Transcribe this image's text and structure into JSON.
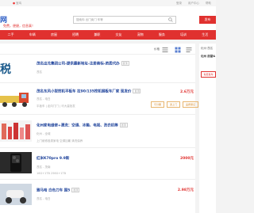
{
  "topbar": {
    "location": "宝鸡",
    "links": [
      "登录",
      "用户中心",
      "帮助"
    ]
  },
  "header": {
    "logo": "网",
    "slogan": "免费，便捷，信息真！",
    "search_placeholder": "搜索你 出门卖门 车等",
    "post_label": "发布"
  },
  "nav": [
    "二手",
    "车辆",
    "房屋",
    "招聘",
    "兼职",
    "交友",
    "宠物",
    "服务",
    "培训",
    "生活"
  ],
  "filter": {
    "price_sort": "价格"
  },
  "listings": [
    {
      "title": "茂名出兑集团公司-提供最新地址-注册商标-资质代办",
      "tag": "置顶",
      "sub": "茂名",
      "sub2": "",
      "price": "",
      "chips": []
    },
    {
      "title": "茂名东风小型挖机平板车 拉90/135挖机钢板车厂家 现发价",
      "tag": "置顶",
      "sub": "茂名 - 电白",
      "sub2": "平板车 | 走向门门 | 可大量批发",
      "price": "2.6万元",
      "chips": [
        "可分期",
        "送上门",
        "品质保证"
      ]
    },
    {
      "title": "化州家电维修+清洗：空调、冰箱、电视、洗衣机等",
      "tag": "置顶",
      "sub": "化州 - 全城",
      "sub2": "上门维修各类家电 空调加氟 清洗保养",
      "price": "",
      "chips": []
    },
    {
      "title": "红米K70pro 9.9新",
      "tag": "",
      "sub": "茂名 - 茂南",
      "sub2": "16G+1TB 256G+1TB",
      "price": "2000元",
      "chips": []
    },
    {
      "title": "雅马哈 白色刀车 国5",
      "tag": "置顶",
      "sub": "茂名 - 电白",
      "sub2": "",
      "price": "2.98万元",
      "chips": []
    }
  ],
  "side": {
    "line1": "化州·茂名",
    "line2": "化州 房屋&",
    "button": "免费发布"
  },
  "colors": {
    "brand_red": "#e0312f",
    "link_blue": "#1a3f99",
    "logo_blue": "#2f5fc5"
  }
}
